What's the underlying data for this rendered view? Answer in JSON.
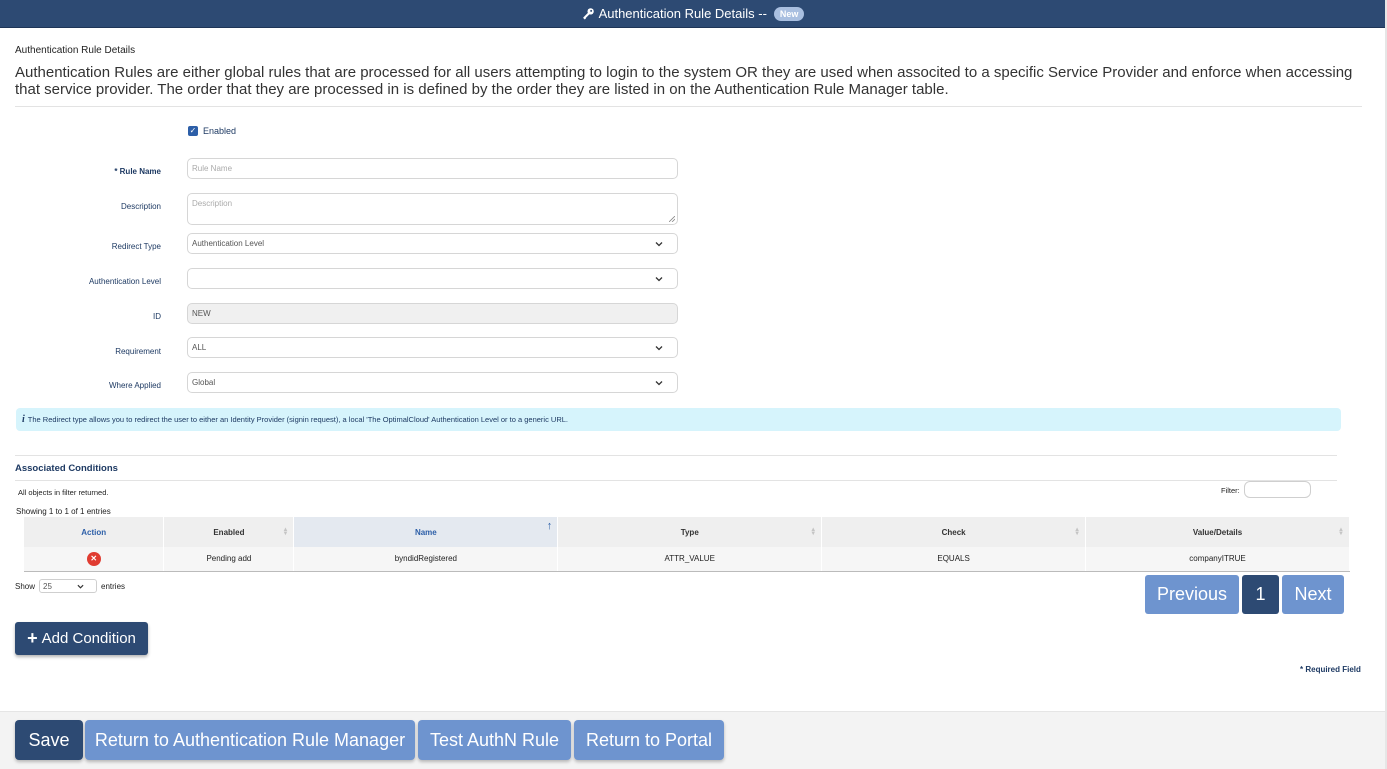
{
  "titlebar": {
    "title": "Authentication Rule Details --",
    "badge": "New",
    "icon": "key-icon"
  },
  "header": {
    "subtitle": "Authentication Rule Details",
    "intro": "Authentication Rules are either global rules that are processed for all users attempting to login to the system OR they are used when associted to a specific Service Provider and enforce when accessing that service provider. The order that they are processed in is defined by the order they are listed in on the Authentication Rule Manager table."
  },
  "form": {
    "enabled_label": "Enabled",
    "enabled_checked": true,
    "rule_name": {
      "label": "* Rule Name",
      "value": "",
      "placeholder": "Rule Name"
    },
    "description": {
      "label": "Description",
      "value": "",
      "placeholder": "Description"
    },
    "redirect_type": {
      "label": "Redirect Type",
      "value": "Authentication Level"
    },
    "authentication_level": {
      "label": "Authentication Level",
      "value": ""
    },
    "id": {
      "label": "ID",
      "value": "NEW"
    },
    "requirement": {
      "label": "Requirement",
      "value": "ALL"
    },
    "where_applied": {
      "label": "Where Applied",
      "value": "Global"
    }
  },
  "info": {
    "icon": "info-icon",
    "text": "The Redirect type allows you to redirect the user to either an Identity Provider (signin request), a local 'The OptimalCloud' Authentication Level or to a generic URL."
  },
  "conditions": {
    "title": "Associated Conditions",
    "filter_note": "All objects in filter returned.",
    "filter_label": "Filter:",
    "filter_value": "",
    "showing": "Showing 1 to 1 of 1 entries",
    "columns": [
      "Action",
      "Enabled",
      "Name",
      "Type",
      "Check",
      "Value/Details"
    ],
    "rows": [
      {
        "enabled": "Pending add",
        "name": "byndidRegistered",
        "type": "ATTR_VALUE",
        "check": "EQUALS",
        "value": "companyITRUE"
      }
    ],
    "show_label": "Show",
    "page_length": "25",
    "entries_label": "entries",
    "pager": {
      "previous": "Previous",
      "current": "1",
      "next": "Next"
    },
    "add_label": "Add Condition"
  },
  "required_note": "* Required Field",
  "footer": {
    "save": "Save",
    "return_manager": "Return to Authentication Rule Manager",
    "test": "Test AuthN Rule",
    "return_portal": "Return to Portal"
  },
  "colors": {
    "primary": "#2d4a73",
    "secondary": "#6e94cf",
    "info_bg": "#d6f4fc",
    "danger": "#e03c31"
  }
}
